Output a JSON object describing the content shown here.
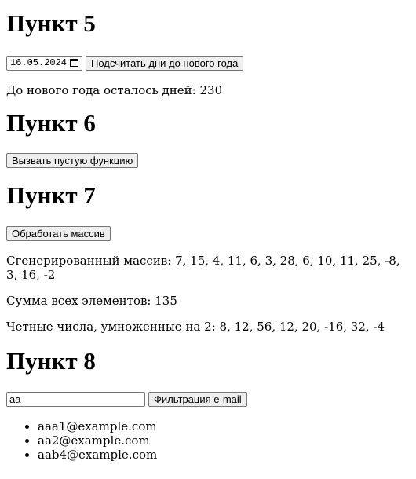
{
  "p5": {
    "heading": "Пункт 5",
    "date_value": "16.05.2024",
    "button_label": "Подсчитать дни до нового года",
    "result_text": "До нового года осталось дней: 230"
  },
  "p6": {
    "heading": "Пункт 6",
    "button_label": "Вызвать пустую функцию"
  },
  "p7": {
    "heading": "Пункт 7",
    "button_label": "Обработать массив",
    "generated_text": "Сгенерированный массив: 7, 15, 4, 11, 6, 3, 28, 6, 10, 11, 25, -8, 3, 16, -2",
    "sum_text": "Сумма всех элементов: 135",
    "even_text": "Четные числа, умноженные на 2: 8, 12, 56, 12, 20, -16, 32, -4"
  },
  "p8": {
    "heading": "Пункт 8",
    "input_value": "aa",
    "button_label": "Фильтрация e-mail",
    "emails": [
      "aaa1@example.com",
      "aa2@example.com",
      "aab4@example.com"
    ]
  }
}
